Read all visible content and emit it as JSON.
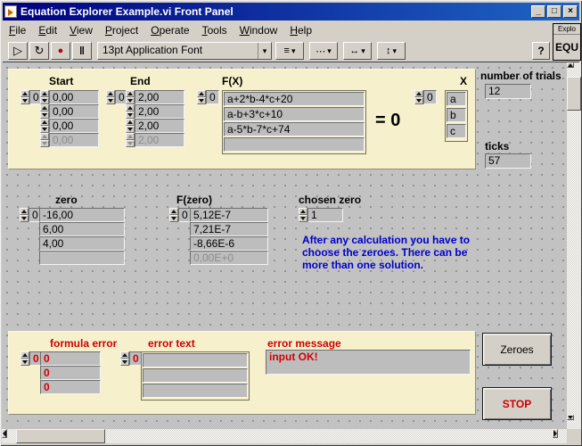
{
  "colors": {
    "titlebar_blue": "#000080",
    "panel_cream": "#f6f1cc",
    "error_red": "#cc0000",
    "note_blue": "#0000cc"
  },
  "window": {
    "title": "Equation Explorer Example.vi Front Panel",
    "minimize_glyph": "_",
    "maximize_glyph": "□",
    "close_glyph": "×"
  },
  "menu": {
    "items": [
      "File",
      "Edit",
      "View",
      "Project",
      "Operate",
      "Tools",
      "Window",
      "Help"
    ]
  },
  "toolbar": {
    "run_glyph": "▷",
    "run_continuous_glyph": "↻",
    "abort_glyph": "●",
    "pause_glyph": "‖",
    "font_selector": "13pt Application Font",
    "align_glyph": "≡",
    "distribute_glyph": "⋯",
    "resize_glyph": "↔",
    "reorder_glyph": "↕",
    "dropdown_glyph": "▾",
    "help_glyph": "?"
  },
  "vi_icon": {
    "line1": "Explo",
    "line2": "EQU"
  },
  "panel": {
    "top": {
      "start": {
        "label": "Start",
        "index": "0",
        "values": [
          "0,00",
          "0,00",
          "0,00",
          "0,00"
        ]
      },
      "end": {
        "label": "End",
        "index": "0",
        "values": [
          "2,00",
          "2,00",
          "2,00",
          "2,00"
        ]
      },
      "fx": {
        "label": "F(X)",
        "index": "0",
        "values": [
          "a+2*b-4*c+20",
          "a-b+3*c+10",
          "a-5*b-7*c+74",
          ""
        ]
      },
      "equals": "= 0",
      "x": {
        "label": "X",
        "index": "0",
        "values": [
          "a",
          "b",
          "c"
        ]
      }
    },
    "trials": {
      "label": "number of trials",
      "value": "12"
    },
    "ticks": {
      "label": "ticks",
      "value": "57"
    },
    "zero": {
      "label": "zero",
      "index": "0",
      "values": [
        "-16,00",
        "6,00",
        "4,00",
        ""
      ]
    },
    "fzero": {
      "label": "F(zero)",
      "index": "0",
      "values": [
        "5,12E-7",
        "7,21E-7",
        "-8,66E-6",
        "0,00E+0"
      ]
    },
    "chosen_zero": {
      "label": "chosen zero",
      "value": "1"
    },
    "note": "After any calculation you have to choose the zeroes. There can be more than one solution.",
    "errors": {
      "formula": {
        "label": "formula error",
        "index": "0",
        "values": [
          "0",
          "0",
          "0"
        ]
      },
      "text": {
        "label": "error text",
        "index": "0",
        "values": [
          "",
          "",
          ""
        ]
      },
      "message": {
        "label": "error message",
        "value": "input OK!"
      }
    },
    "buttons": {
      "zeroes": "Zeroes",
      "stop": "STOP"
    }
  }
}
